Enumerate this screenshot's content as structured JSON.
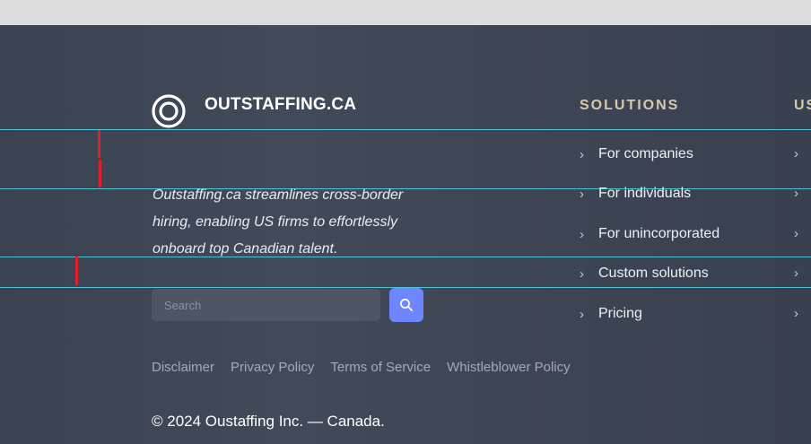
{
  "brand": {
    "name": "OUTSTAFFING.CA",
    "logo_icon": "ring-logo-icon"
  },
  "tagline": "Outstaffing.ca streamlines cross-border hiring, enabling US firms to effortlessly onboard top Canadian talent.",
  "search": {
    "placeholder": "Search",
    "button_icon": "search-icon"
  },
  "solutions": {
    "heading": "SOLUTIONS",
    "items": [
      {
        "label": "For companies"
      },
      {
        "label": "For individuals"
      },
      {
        "label": "For unincorporated"
      },
      {
        "label": "Custom solutions"
      },
      {
        "label": "Pricing"
      }
    ]
  },
  "next_column": {
    "heading": "US"
  },
  "legal_links": [
    "Disclaimer",
    "Privacy Policy",
    "Terms of Service",
    "Whistleblower Policy"
  ],
  "copyright": "© 2024 Oustaffing Inc. — Canada.",
  "colors": {
    "background": "#3f4756",
    "accent": "#6e86ff",
    "heading": "#d9c9aa",
    "guide_line": "#4fd2e6",
    "marker": "#e0202a"
  }
}
